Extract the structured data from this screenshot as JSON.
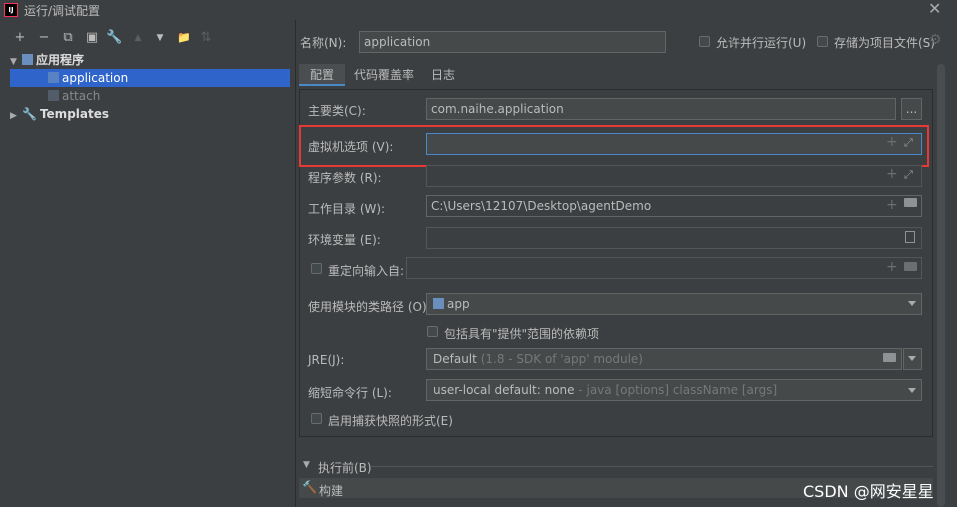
{
  "window": {
    "title": "运行/调试配置",
    "logo": "IJ"
  },
  "toolbar": {
    "add": "+",
    "remove": "−",
    "copy": "⧉",
    "save": "▣",
    "wrench": "🔧",
    "up": "▲",
    "down": "▼",
    "folder": "📁",
    "sort": "⇅"
  },
  "tree": {
    "group_label": "应用程序",
    "items": [
      {
        "label": "application"
      },
      {
        "label": "attach"
      }
    ],
    "templates_label": "Templates"
  },
  "name_label": "名称(N):",
  "name_value": "application",
  "allow_parallel": "允许并行运行(U)",
  "store_as_project": "存储为项目文件(S)",
  "tabs": [
    "配置",
    "代码覆盖率",
    "日志"
  ],
  "form": {
    "main_class_label": "主要类(C):",
    "main_class_value": "com.naihe.application",
    "browse": "...",
    "vm_options_label": "虚拟机选项 (V):",
    "vm_options_value": "",
    "program_args_label": "程序参数 (R):",
    "working_dir_label": "工作目录 (W):",
    "working_dir_value": "C:\\Users\\12107\\Desktop\\agentDemo",
    "env_label": "环境变量 (E):",
    "redirect_label": "重定向输入自:",
    "module_label": "使用模块的类路径 (O):",
    "module_value": "app",
    "include_provided": "包括具有\"提供\"范围的依赖项",
    "jre_label": "JRE(J):",
    "jre_default": "Default",
    "jre_hint": "(1.8 - SDK of 'app' module)",
    "shorten_label": "缩短命令行 (L):",
    "shorten_value": "user-local default: none",
    "shorten_hint": " - java [options] className [args]",
    "snapshot_label": "启用捕获快照的形式(E)"
  },
  "before_launch": {
    "label": "执行前(B)",
    "item": "构建"
  },
  "watermark": "CSDN @网安星星",
  "colors": {
    "bg": "#3c3f41",
    "selection": "#2f65ca",
    "highlight": "#e53935"
  }
}
